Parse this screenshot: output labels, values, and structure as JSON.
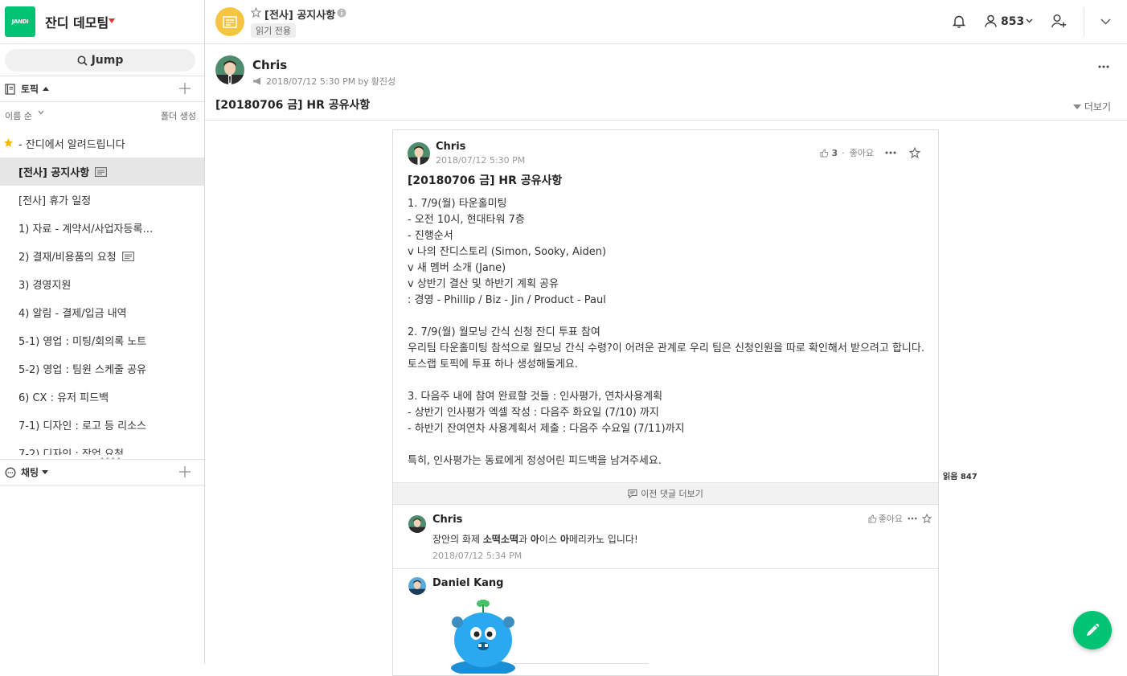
{
  "team": {
    "logo_text": "JANDI",
    "name": "잔디 데모팀"
  },
  "jump": {
    "label": "Jump"
  },
  "sidebar": {
    "topics_section": {
      "label": "토픽"
    },
    "sort_label": "이름 순",
    "folder_create": "폴더 생성",
    "topics": [
      {
        "label": "- 잔디에서 알려드립니다",
        "starred": true
      },
      {
        "label": "[전사] 공지사항",
        "active": true,
        "announcement": true
      },
      {
        "label": "[전사] 휴가 일정"
      },
      {
        "label": "1) 자료 - 계약서/사업자등록…"
      },
      {
        "label": "2) 결재/비용품의 요청",
        "announcement": true
      },
      {
        "label": "3) 경영지원"
      },
      {
        "label": "4) 알림 - 결제/입금 내역"
      },
      {
        "label": "5-1) 영업 : 미팅/회의록 노트"
      },
      {
        "label": "5-2) 영업 : 팀원 스케줄 공유"
      },
      {
        "label": "6) CX : 유저 피드백"
      },
      {
        "label": "7-1) 디자인 : 로고 등 리소스"
      },
      {
        "label": "7-2) 디자인 : 작업 요청"
      }
    ],
    "resize_handle": "••••",
    "chat_section": {
      "label": "채팅"
    }
  },
  "header": {
    "title": "[전사] 공지사항",
    "badge": "읽기 전용",
    "member_count": "853"
  },
  "post": {
    "author": "Chris",
    "datetime": "2018/07/12 5:30 PM",
    "by_label": "by",
    "by_user": "황진성",
    "title": "[20180706 금] HR 공유사항",
    "expand_label": "더보기"
  },
  "card": {
    "author": "Chris",
    "time": "2018/07/12 5:30 PM",
    "like_count": "3",
    "like_separator": "·",
    "like_label": "좋아요",
    "title": "[20180706 금] HR 공유사항",
    "body": [
      "1. 7/9(월) 타운홀미팅",
      "- 오전 10시, 현대타워 7층",
      "- 진행순서",
      "v 나의 잔디스토리 (Simon, Sooky, Aiden)",
      "v 새 멤버 소개 (Jane)",
      "v 상반기 결산 및 하반기 계획 공유",
      ": 경영 - Phillip / Biz - Jin / Product - Paul",
      "",
      "2. 7/9(월) 월모닝 간식 신청 잔디 투표 참여",
      "우리팀 타운홀미팅 참석으로 월모닝 간식 수령?이 어려운 관계로 우리 팀은 신청인원을 따로 확인해서 받으려고 합니다.  토스랩 토픽에 투표 하나 생성해둘게요.",
      "",
      "3. 다음주 내에 참여 완료할 것들 : 인사평가, 연차사용계획",
      "- 상반기 인사평가 엑셀 작성 : 다음주 화요일 (7/10) 까지",
      "- 하반기 잔여연차 사용계획서 제출 : 다음주 수요일 (7/11)까지",
      "",
      "특히, 인사평가는 동료에게 정성어린 피드백을 남겨주세요."
    ],
    "prev_comments": "이전 댓글 더보기",
    "read_count": "읽음 847"
  },
  "comments": [
    {
      "author": "Chris",
      "text_parts": [
        "장안의 화제 ",
        "소떡소떡",
        "과 ",
        "아",
        "이스 ",
        "아",
        "메리카노 입니다!"
      ],
      "time": "2018/07/12 5:34 PM",
      "like_label": "좋아요"
    },
    {
      "author": "Daniel Kang"
    }
  ],
  "colors": {
    "brand": "#00c473",
    "topic_avatar": "#f5c542",
    "team_caret": "#e0312f"
  }
}
